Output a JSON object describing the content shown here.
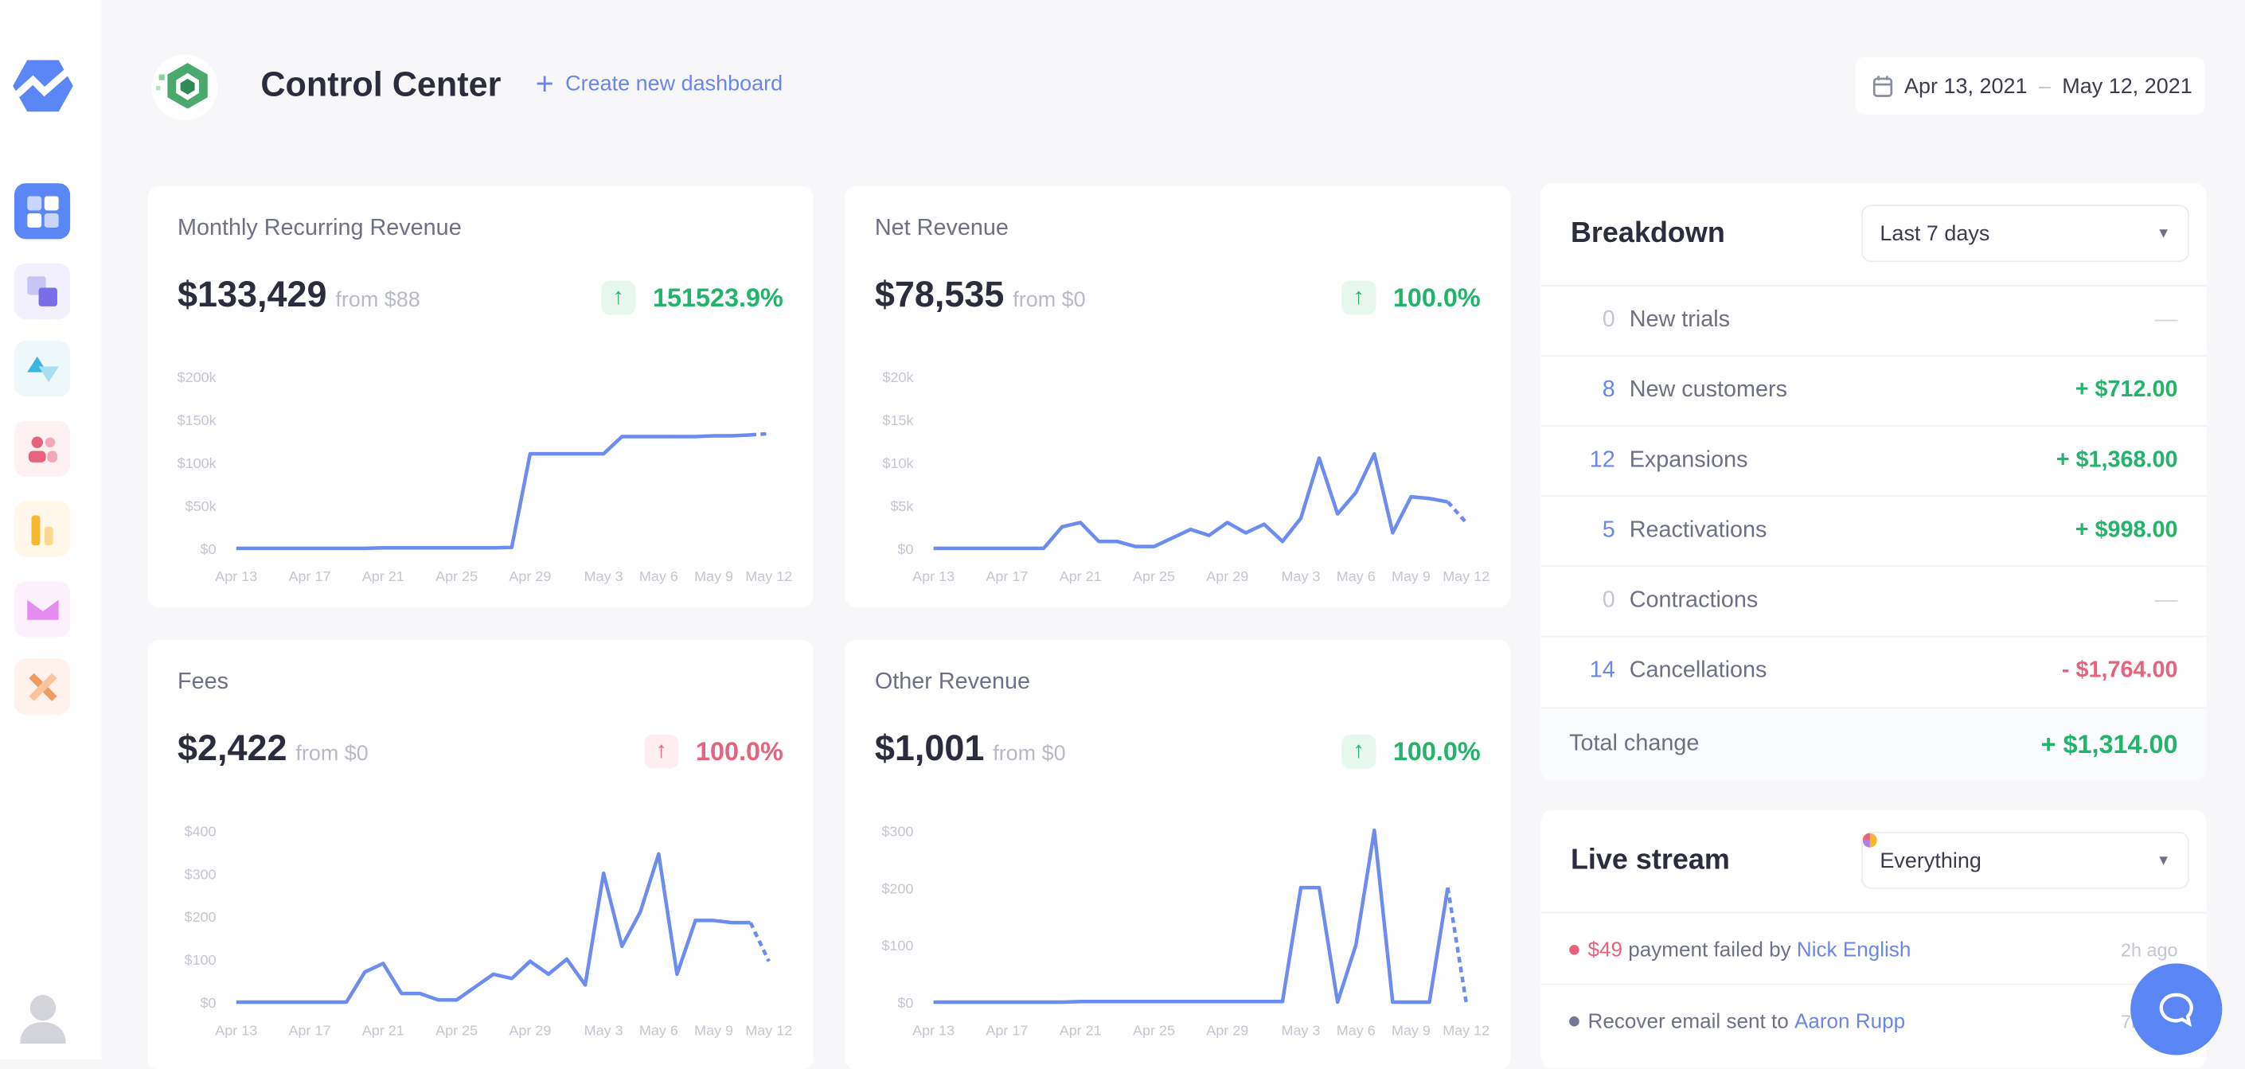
{
  "header": {
    "title": "Control Center",
    "create_label": "Create new dashboard",
    "date_start": "Apr 13, 2021",
    "date_sep": "–",
    "date_end": "May 12, 2021"
  },
  "sidebar": {
    "items": [
      "dashboards",
      "integrations",
      "analytics",
      "customers",
      "reports",
      "emails",
      "tools"
    ]
  },
  "colors": {
    "line": "#6c8cf0",
    "green": "#22b46a",
    "red": "#e5637c",
    "blue": "#6c86e8"
  },
  "cards": [
    {
      "title": "Monthly Recurring Revenue",
      "value": "$133,429",
      "from": "from $88",
      "change": "151523.9%",
      "trend": "up",
      "trend_color": "green"
    },
    {
      "title": "Net Revenue",
      "value": "$78,535",
      "from": "from $0",
      "change": "100.0%",
      "trend": "up",
      "trend_color": "green"
    },
    {
      "title": "Fees",
      "value": "$2,422",
      "from": "from $0",
      "change": "100.0%",
      "trend": "up",
      "trend_color": "red"
    },
    {
      "title": "Other Revenue",
      "value": "$1,001",
      "from": "from $0",
      "change": "100.0%",
      "trend": "up",
      "trend_color": "green"
    }
  ],
  "chart_data": [
    {
      "type": "line",
      "ylim": [
        0,
        200000
      ],
      "yticks": [
        "$0",
        "$50k",
        "$100k",
        "$150k",
        "$200k"
      ],
      "xticks": [
        "Apr 13",
        "Apr 17",
        "Apr 21",
        "Apr 25",
        "Apr 29",
        "May 3",
        "May 6",
        "May 9",
        "May 12"
      ],
      "xtick_days": [
        0,
        4,
        8,
        12,
        16,
        20,
        23,
        26,
        29
      ],
      "values": [
        0,
        0,
        0,
        0,
        0,
        0,
        0,
        0,
        500,
        500,
        500,
        500,
        500,
        500,
        500,
        1000,
        110000,
        110000,
        110000,
        110000,
        110000,
        130000,
        130000,
        130000,
        130000,
        130000,
        131000,
        131000,
        132000,
        133429
      ],
      "last_segment": "dashed"
    },
    {
      "type": "line",
      "ylim": [
        0,
        20000
      ],
      "yticks": [
        "$0",
        "$5k",
        "$10k",
        "$15k",
        "$20k"
      ],
      "xticks": [
        "Apr 13",
        "Apr 17",
        "Apr 21",
        "Apr 25",
        "Apr 29",
        "May 3",
        "May 6",
        "May 9",
        "May 12"
      ],
      "xtick_days": [
        0,
        4,
        8,
        12,
        16,
        20,
        23,
        26,
        29
      ],
      "values": [
        0,
        0,
        0,
        0,
        0,
        0,
        0,
        2500,
        3000,
        800,
        800,
        200,
        200,
        1200,
        2200,
        1500,
        3000,
        1800,
        2800,
        800,
        3500,
        10500,
        4000,
        6500,
        11000,
        1800,
        6000,
        5800,
        5400,
        3000
      ],
      "last_segment": "dashed"
    },
    {
      "type": "line",
      "ylim": [
        0,
        400
      ],
      "yticks": [
        "$0",
        "$100",
        "$200",
        "$300",
        "$400"
      ],
      "xticks": [
        "Apr 13",
        "Apr 17",
        "Apr 21",
        "Apr 25",
        "Apr 29",
        "May 3",
        "May 6",
        "May 9",
        "May 12"
      ],
      "xtick_days": [
        0,
        4,
        8,
        12,
        16,
        20,
        23,
        26,
        29
      ],
      "values": [
        0,
        0,
        0,
        0,
        0,
        0,
        0,
        70,
        90,
        20,
        20,
        5,
        5,
        35,
        65,
        55,
        95,
        65,
        100,
        40,
        300,
        130,
        210,
        345,
        65,
        190,
        190,
        185,
        185,
        95
      ],
      "last_segment": "dashed"
    },
    {
      "type": "line",
      "ylim": [
        0,
        300
      ],
      "yticks": [
        "$0",
        "$100",
        "$200",
        "$300"
      ],
      "xticks": [
        "Apr 13",
        "Apr 17",
        "Apr 21",
        "Apr 25",
        "Apr 29",
        "May 3",
        "May 6",
        "May 9",
        "May 12"
      ],
      "xtick_days": [
        0,
        4,
        8,
        12,
        16,
        20,
        23,
        26,
        29
      ],
      "values": [
        0,
        0,
        0,
        0,
        0,
        0,
        0,
        0,
        1,
        1,
        1,
        1,
        1,
        1,
        1,
        1,
        1,
        1,
        1,
        1,
        200,
        200,
        0,
        100,
        300,
        0,
        0,
        0,
        200,
        0
      ],
      "last_segment": "dashed"
    }
  ],
  "breakdown": {
    "title": "Breakdown",
    "period": "Last 7 days",
    "rows": [
      {
        "count": "0",
        "label": "New trials",
        "amount": "—",
        "kind": "none"
      },
      {
        "count": "8",
        "label": "New customers",
        "amount": "+ $712.00",
        "kind": "pos"
      },
      {
        "count": "12",
        "label": "Expansions",
        "amount": "+ $1,368.00",
        "kind": "pos"
      },
      {
        "count": "5",
        "label": "Reactivations",
        "amount": "+ $998.00",
        "kind": "pos"
      },
      {
        "count": "0",
        "label": "Contractions",
        "amount": "—",
        "kind": "none"
      },
      {
        "count": "14",
        "label": "Cancellations",
        "amount": "- $1,764.00",
        "kind": "neg"
      }
    ],
    "total_label": "Total change",
    "total_amount": "+ $1,314.00"
  },
  "livestream": {
    "title": "Live stream",
    "filter": "Everything",
    "events": [
      {
        "amount": "$49",
        "text": "payment failed by",
        "person": "Nick English",
        "time": "2h ago",
        "dot": "#e5637c"
      },
      {
        "amount": "",
        "text": "Recover email sent to",
        "person": "Aaron Rupp",
        "time": "7h ago",
        "dot": "#767891"
      }
    ]
  }
}
